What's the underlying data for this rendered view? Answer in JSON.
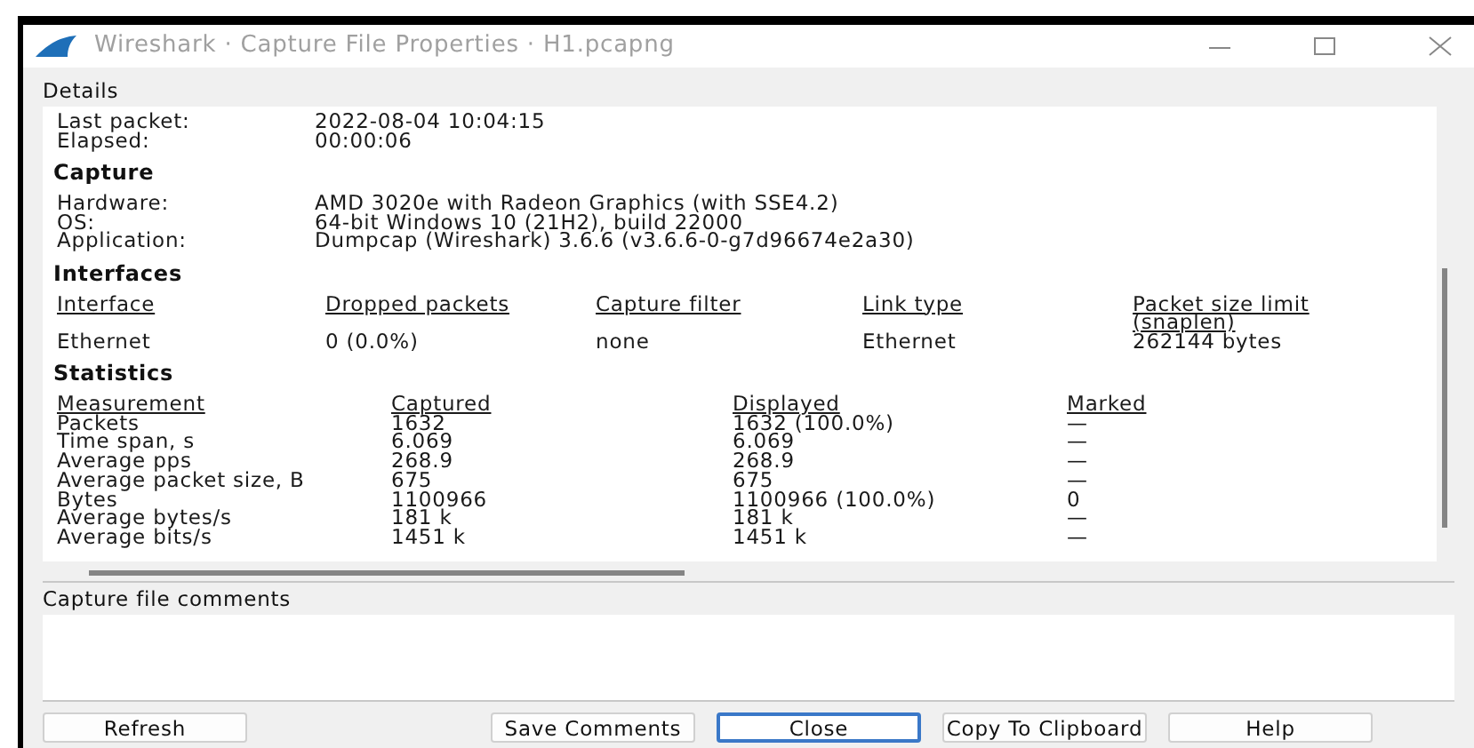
{
  "window": {
    "title": "Wireshark · Capture File Properties · H1.pcapng"
  },
  "details": {
    "label": "Details",
    "top_fields": [
      {
        "label": "Last packet:",
        "value": "2022-08-04 10:04:15"
      },
      {
        "label": "Elapsed:",
        "value": "00:00:06"
      }
    ],
    "sections": [
      {
        "title": "Capture",
        "kind": "fields",
        "fields": [
          {
            "label": "Hardware:",
            "value": "AMD 3020e with Radeon Graphics (with SSE4.2)"
          },
          {
            "label": "OS:",
            "value": "64-bit Windows 10 (21H2), build 22000"
          },
          {
            "label": "Application:",
            "value": "Dumpcap (Wireshark) 3.6.6 (v3.6.6-0-g7d96674e2a30)"
          }
        ]
      },
      {
        "title": "Interfaces",
        "kind": "interfaces",
        "columns": [
          "Interface",
          "Dropped packets",
          "Capture filter",
          "Link type",
          "Packet size limit (snaplen)"
        ],
        "rows": [
          [
            "Ethernet",
            "0 (0.0%)",
            "none",
            "Ethernet",
            "262144 bytes"
          ]
        ]
      },
      {
        "title": "Statistics",
        "kind": "statistics",
        "columns": [
          "Measurement",
          "Captured",
          "Displayed",
          "Marked"
        ],
        "rows": [
          [
            "Packets",
            "1632",
            "1632 (100.0%)",
            "—"
          ],
          [
            "Time span, s",
            "6.069",
            "6.069",
            "—"
          ],
          [
            "Average pps",
            "268.9",
            "268.9",
            "—"
          ],
          [
            "Average packet size, B",
            "675",
            "675",
            "—"
          ],
          [
            "Bytes",
            "1100966",
            "1100966 (100.0%)",
            "0"
          ],
          [
            "Average bytes/s",
            "181 k",
            "181 k",
            "—"
          ],
          [
            "Average bits/s",
            "1451 k",
            "1451 k",
            "—"
          ]
        ]
      }
    ]
  },
  "comments": {
    "label": "Capture file comments"
  },
  "buttons": [
    {
      "label": "Refresh",
      "focused": false
    },
    {
      "label": "Save Comments",
      "focused": false
    },
    {
      "label": "Close",
      "focused": true
    },
    {
      "label": "Copy To Clipboard",
      "focused": false
    },
    {
      "label": "Help",
      "focused": false
    }
  ]
}
